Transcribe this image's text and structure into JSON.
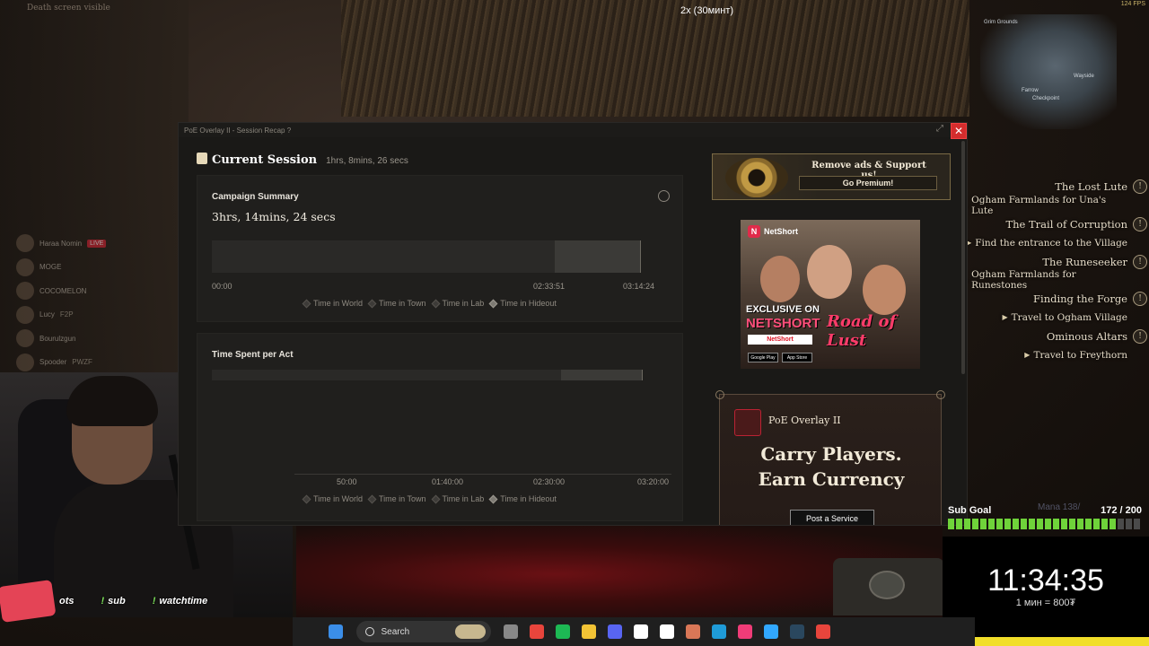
{
  "stream": {
    "title": "2x (30минт)",
    "death_text": "Death screen visible",
    "fps": "124 FPS"
  },
  "minimap": {
    "labels": [
      "Grim Grounds",
      "Wayside",
      "Farrow",
      "Checkpoint"
    ]
  },
  "quests": [
    {
      "text": "The Lost Lute",
      "type": "main"
    },
    {
      "text": "Ogham Farmlands for Una's Lute",
      "type": "sub"
    },
    {
      "text": "The Trail of Corruption",
      "type": "main"
    },
    {
      "text": "Find the entrance to the Village",
      "type": "sub"
    },
    {
      "text": "The Runeseeker",
      "type": "main"
    },
    {
      "text": "Ogham Farmlands for Runestones",
      "type": "sub"
    },
    {
      "text": "Finding the Forge",
      "type": "main"
    },
    {
      "text": "Travel to Ogham Village",
      "type": "sub"
    },
    {
      "text": "Ominous Altars",
      "type": "main"
    },
    {
      "text": "Travel to Freythorn",
      "type": "sub"
    }
  ],
  "chat": [
    {
      "name": "Haraa Nomin",
      "badge": "",
      "live": "LIVE"
    },
    {
      "name": "MOGE",
      "badge": "",
      "live": ""
    },
    {
      "name": "COCOMELON",
      "badge": "",
      "live": ""
    },
    {
      "name": "Lucy",
      "badge": "F2P",
      "live": ""
    },
    {
      "name": "Bourulzgun",
      "badge": "",
      "live": ""
    },
    {
      "name": "Spooder",
      "badge": "PWZF",
      "live": ""
    }
  ],
  "commands": [
    {
      "label": "ots"
    },
    {
      "label": "sub"
    },
    {
      "label": "watchtime"
    }
  ],
  "overlay": {
    "window_title": "PoE Overlay II - Session Recap ?",
    "close_label": "✕",
    "session_title": "Current Session",
    "session_duration": "1hrs, 8mins, 26 secs",
    "campaign": {
      "title": "Campaign Summary",
      "total": "3hrs, 14mins, 24 secs",
      "bar_fill_start_fraction": 0.8,
      "ticks": [
        "00:00",
        "02:33:51",
        "03:14:24"
      ]
    },
    "acts": {
      "title": "Time Spent per Act",
      "bar_fill_start_fraction": 0.81,
      "ticks": [
        "50:00",
        "01:40:00",
        "02:30:00",
        "03:20:00"
      ]
    },
    "legend": [
      "Time in World",
      "Time in Town",
      "Time in Lab",
      "Time in Hideout"
    ],
    "premium": {
      "headline": "Remove ads & Support us!",
      "button": "Go Premium!"
    },
    "netshort_ad": {
      "brand": "NetShort",
      "exclusive": "EXCLUSIVE ON",
      "netshort": "NETSHORT",
      "title": "Road of Lust",
      "badge": "NetShort",
      "store1": "Google Play",
      "store2": "App Store"
    },
    "poe_ad": {
      "name": "PoE Overlay II",
      "line1": "Carry Players.",
      "line2": "Earn Currency",
      "button": "Post a Service"
    }
  },
  "subgoal": {
    "label": "Sub Goal",
    "count": "172 / 200",
    "progress": 0.86,
    "mana": "Mana   138/"
  },
  "timer": {
    "time": "11:34:35",
    "rate": "1 мин = 800₮"
  },
  "taskbar": {
    "search": "Search",
    "icons": [
      "windows-start-icon",
      "search-icon",
      "copilot-icon",
      "chrome-icon",
      "spotify-icon",
      "file-explorer-icon",
      "discord-icon",
      "capcut-icon",
      "notion-icon",
      "claude-icon",
      "edge-icon",
      "itunes-icon",
      "photoshop-icon",
      "steam-icon",
      "chrome-alt-icon"
    ]
  },
  "colors": {
    "close_red": "#d42d2d",
    "subgoal_green": "#6fd33a",
    "accent_gold": "#c19a44"
  }
}
